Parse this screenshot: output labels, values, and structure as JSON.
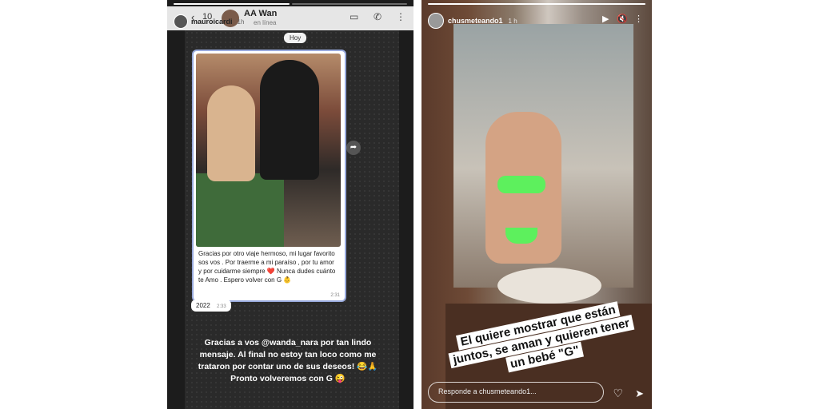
{
  "left_story": {
    "username": "mauroicardi",
    "time": "1h",
    "whatsapp": {
      "back_count": "10",
      "contact_name": "AA Wan",
      "contact_status": "en línea",
      "day_label": "Hoy",
      "caption": "Gracias por otro viaje hermoso, mi lugar favorito sos vos . Por traerme a mi paraíso , por tu amor y por cuidarme siempre ❤️ Nunca dudes cuánto te Amo . Espero volver con G 👶",
      "caption_time": "2:31",
      "year_bubble": "2022",
      "year_time": "2:33"
    },
    "overlay_text": "Gracias a vos @wanda_nara por tan lindo mensaje. Al final no estoy tan loco como me trataron por contar uno de sus deseos! 😂🙏 Pronto volveremos con G 😜"
  },
  "right_story": {
    "username": "chusmeteando1",
    "time": "1 h",
    "sticker_text": "El quiere mostrar que están juntos, se aman y quieren tener un bebé \"G\"",
    "reply_placeholder": "Responde a chusmeteando1..."
  },
  "icons": {
    "back": "‹",
    "video": "▭",
    "call": "✆",
    "more": "⋮",
    "play": "▶",
    "mute": "🔇",
    "forward": "➦",
    "heart": "♡",
    "send": "➤"
  }
}
